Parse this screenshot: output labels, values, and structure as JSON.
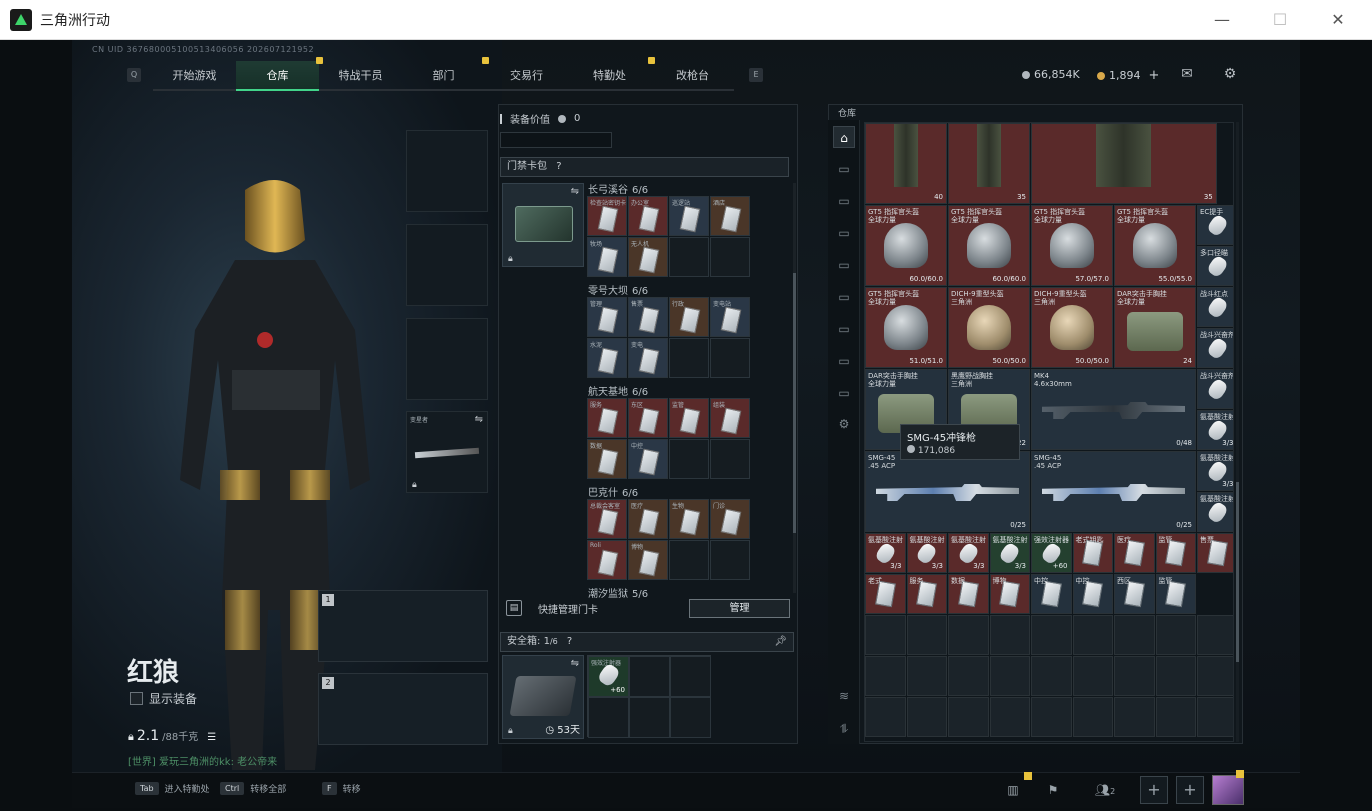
{
  "window": {
    "title": "三角洲行动",
    "minimize": "—",
    "maximize": "☐",
    "close": "✕"
  },
  "uid": "CN UID 3676800051005134060​56 202607121952",
  "nav": {
    "key_left": "Q",
    "key_right": "E",
    "tabs": [
      {
        "label": "开始游戏",
        "active": false,
        "badge": false
      },
      {
        "label": "仓库",
        "active": true,
        "badge": false
      },
      {
        "label": "特战干员",
        "active": false,
        "badge": true
      },
      {
        "label": "部门",
        "active": false,
        "badge": false
      },
      {
        "label": "交易行",
        "active": false,
        "badge": true
      },
      {
        "label": "特勤处",
        "active": false,
        "badge": false
      },
      {
        "label": "改枪台",
        "active": false,
        "badge": true
      }
    ]
  },
  "currency": {
    "silver": "66,854K",
    "gold": "1,894",
    "add": "+"
  },
  "operator": {
    "name": "红狼",
    "show_gear": "显示装备",
    "weight": "2.1",
    "weight_max": "/88千克"
  },
  "chat": "[世界] 爱玩三角洲的kk: 老公帝来",
  "weapon_slots": [
    "1",
    "2"
  ],
  "equip_slot_label": "变星者",
  "middle": {
    "equip_value_label": "装备价值",
    "equip_value": "0",
    "keycard_header": "门禁卡包",
    "help": "?",
    "regions": [
      {
        "name": "长弓溪谷",
        "count": "6/6",
        "cards": [
          {
            "label": "检查站密钥卡",
            "color": "red"
          },
          {
            "label": "办公室",
            "color": "red"
          },
          {
            "label": "巡逻站",
            "color": "blue"
          },
          {
            "label": "酒店",
            "color": "brown"
          },
          {
            "label": "牧场",
            "color": "blue"
          },
          {
            "label": "无人机",
            "color": "brown"
          }
        ]
      },
      {
        "name": "零号大坝",
        "count": "6/6",
        "cards": [
          {
            "label": "管理",
            "color": "blue"
          },
          {
            "label": "售票",
            "color": "blue"
          },
          {
            "label": "行政",
            "color": "brown"
          },
          {
            "label": "变电站",
            "color": "blue"
          },
          {
            "label": "水泥",
            "color": "blue"
          },
          {
            "label": "变电",
            "color": "blue"
          }
        ]
      },
      {
        "name": "航天基地",
        "count": "6/6",
        "cards": [
          {
            "label": "服务",
            "color": "red"
          },
          {
            "label": "东区",
            "color": "red"
          },
          {
            "label": "监管",
            "color": "red"
          },
          {
            "label": "组装",
            "color": "red"
          },
          {
            "label": "数据",
            "color": "brown"
          },
          {
            "label": "中控",
            "color": "blue"
          }
        ]
      },
      {
        "name": "巴克什",
        "count": "6/6",
        "cards": [
          {
            "label": "总裁会客室",
            "color": "red"
          },
          {
            "label": "医疗",
            "color": "brown"
          },
          {
            "label": "生物",
            "color": "brown"
          },
          {
            "label": "门诊",
            "color": "brown"
          },
          {
            "label": "Roli",
            "color": "red"
          },
          {
            "label": "博物",
            "color": "brown"
          }
        ]
      },
      {
        "name": "潮汐监狱",
        "count": "5/6",
        "cards": []
      }
    ],
    "quick_manage": "快捷管理门卡",
    "manage_button": "管理",
    "safe_box": {
      "label": "安全箱:",
      "used": "1",
      "total": "/6",
      "days": "53天",
      "item": "强效注射器",
      "item_qty": "+60"
    }
  },
  "warehouse": {
    "title": "仓库",
    "tooltip": {
      "name": "SMG-45冲锋枪",
      "price": "171,086"
    },
    "items": [
      {
        "name": "",
        "qty": "40",
        "kind": "pants",
        "color": "red"
      },
      {
        "name": "",
        "qty": "35",
        "kind": "pants",
        "color": "red"
      },
      {
        "name": "",
        "qty": "35",
        "kind": "pants",
        "color": "red"
      },
      {
        "name": "GT5 指挥官头盔",
        "sub": "全球力量",
        "qty": "60.0/60.0",
        "kind": "helmet"
      },
      {
        "name": "GT5 指挥官头盔",
        "sub": "全球力量",
        "qty": "60.0/60.0",
        "kind": "helmet"
      },
      {
        "name": "GT5 指挥官头盔",
        "sub": "全球力量",
        "qty": "57.0/57.0",
        "kind": "helmet"
      },
      {
        "name": "GT5 指挥官头盔",
        "sub": "全球力量",
        "qty": "55.0/55.0",
        "kind": "helmet"
      },
      {
        "name": "EC提手",
        "sub": "",
        "qty": "",
        "kind": "small"
      },
      {
        "name": "多口径瞄",
        "sub": "",
        "qty": "",
        "kind": "small"
      },
      {
        "name": "GT5 指挥官头盔",
        "sub": "全球力量",
        "qty": "51.0/51.0",
        "kind": "helmet"
      },
      {
        "name": "DICH-9重型头盔",
        "sub": "三角洲",
        "qty": "50.0/50.0",
        "kind": "helmet-tan"
      },
      {
        "name": "DICH-9重型头盔",
        "sub": "三角洲",
        "qty": "50.0/50.0",
        "kind": "helmet-tan"
      },
      {
        "name": "DAR突击手胸挂",
        "sub": "全球力量",
        "qty": "24",
        "kind": "vest"
      },
      {
        "name": "战斗红点",
        "sub": "",
        "qty": "",
        "kind": "small"
      },
      {
        "name": "战斗兴奋剂",
        "sub": "",
        "qty": "",
        "kind": "small"
      },
      {
        "name": "DAR突击手胸挂",
        "sub": "全球力量",
        "qty": "",
        "kind": "vest"
      },
      {
        "name": "黑鹰野战胸挂",
        "sub": "三角洲",
        "qty": "22",
        "kind": "vest"
      },
      {
        "name": "MK4",
        "sub": "4.6x30mm",
        "qty": "0/48",
        "kind": "gun-dark"
      },
      {
        "name": "战斗兴奋剂",
        "sub": "",
        "qty": "",
        "kind": "small"
      },
      {
        "name": "氨基酸注射",
        "sub": "",
        "qty": "3/3",
        "kind": "inj"
      },
      {
        "name": "SMG-45",
        "sub": ".45 ACP",
        "qty": "0/25",
        "kind": "gun"
      },
      {
        "name": "SMG-45",
        "sub": ".45 ACP",
        "qty": "0/25",
        "kind": "gun"
      },
      {
        "name": "氨基酸注射",
        "sub": "",
        "qty": "3/3",
        "kind": "inj"
      },
      {
        "name": "氨基酸注射",
        "sub": "",
        "qty": "",
        "kind": "inj"
      }
    ],
    "row_small": [
      {
        "name": "氨基酸注射",
        "qty": "3/3",
        "kind": "inj",
        "color": "red"
      },
      {
        "name": "氨基酸注射",
        "qty": "3/3",
        "kind": "inj",
        "color": "red"
      },
      {
        "name": "氨基酸注射",
        "qty": "3/3",
        "kind": "inj",
        "color": "red"
      },
      {
        "name": "氨基酸注射",
        "qty": "3/3",
        "kind": "inj",
        "color": "green"
      },
      {
        "name": "强效注射器",
        "qty": "+60",
        "kind": "inj",
        "color": "green"
      },
      {
        "name": "老式钥匙",
        "qty": "",
        "kind": "card",
        "color": "red"
      },
      {
        "name": "医疗",
        "qty": "",
        "kind": "card",
        "color": "red"
      },
      {
        "name": "监管",
        "qty": "",
        "kind": "card",
        "color": "red"
      },
      {
        "name": "售票",
        "qty": "",
        "kind": "card",
        "color": "red"
      },
      {
        "name": "变电",
        "qty": "",
        "kind": "card",
        "color": "red"
      }
    ],
    "row_small2": [
      {
        "name": "老式",
        "kind": "card",
        "color": "red"
      },
      {
        "name": "服务",
        "kind": "card",
        "color": "red"
      },
      {
        "name": "数据",
        "kind": "card",
        "color": "red"
      },
      {
        "name": "博物",
        "kind": "card",
        "color": "red"
      },
      {
        "name": "中控",
        "kind": "card",
        "color": "blue"
      },
      {
        "name": "中控",
        "kind": "card",
        "color": "blue"
      },
      {
        "name": "西区",
        "kind": "card",
        "color": "blue"
      },
      {
        "name": "监管",
        "kind": "card",
        "color": "blue"
      }
    ]
  },
  "bottom": {
    "hints": [
      {
        "key": "Tab",
        "label": "进入特勤处"
      },
      {
        "key": "Ctrl",
        "label": "转移全部"
      },
      {
        "key": "F",
        "label": "转移"
      }
    ],
    "friends": "2"
  },
  "colors": {
    "accent": "#42d48a",
    "badge": "#e8c23c",
    "red_cell": "#5a2a2a",
    "blue_cell": "#2a3746"
  }
}
